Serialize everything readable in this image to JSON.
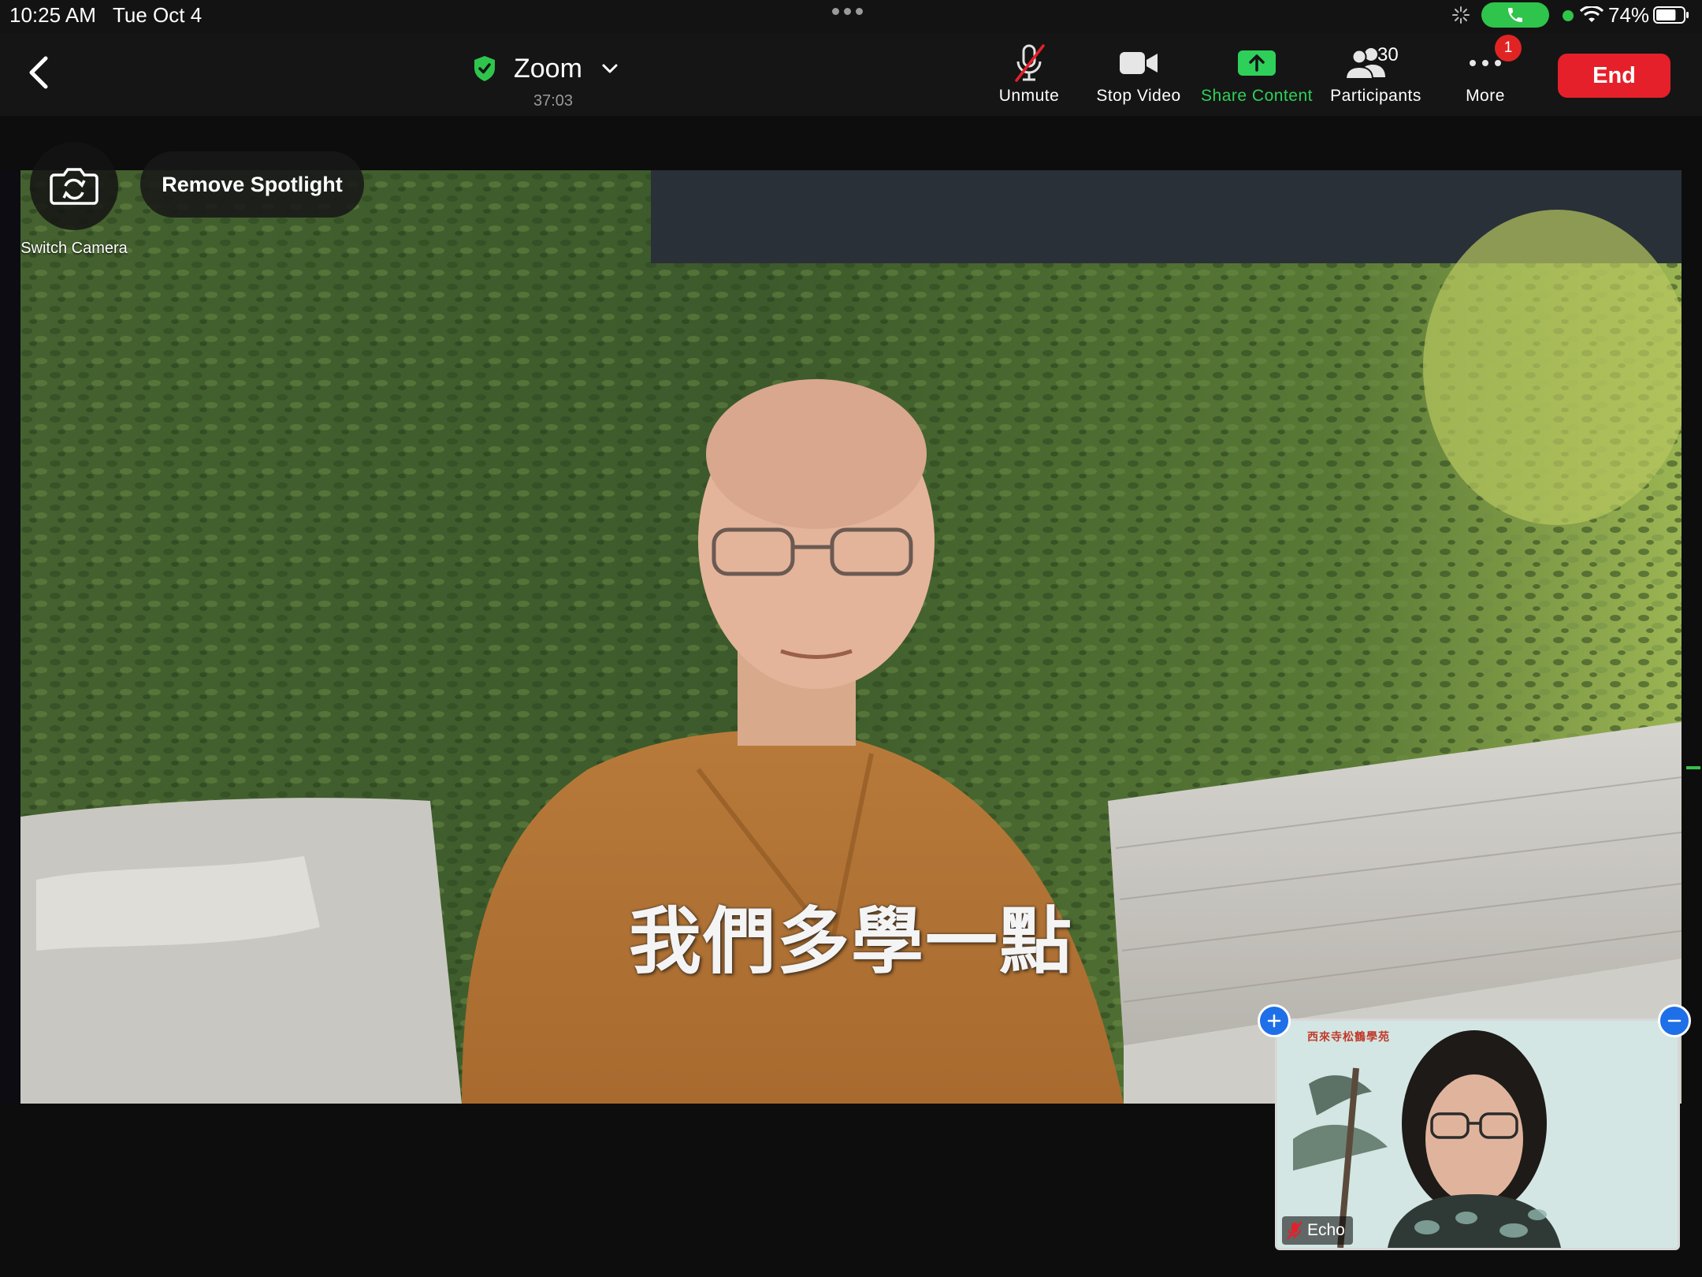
{
  "status_bar": {
    "time": "10:25 AM",
    "date": "Tue Oct 4",
    "battery_percent": "74%",
    "battery_level": 0.74,
    "call_active_color": "#2fc44c"
  },
  "toolbar": {
    "meeting_title": "Zoom",
    "meeting_elapsed": "37:03",
    "unmute_label": "Unmute",
    "stop_video_label": "Stop Video",
    "share_content_label": "Share Content",
    "participants_label": "Participants",
    "participants_count": "30",
    "more_label": "More",
    "more_badge": "1",
    "end_label": "End"
  },
  "video": {
    "switch_camera_label": "Switch Camera",
    "remove_spotlight_label": "Remove Spotlight",
    "subtitle": "我們多學一點"
  },
  "self_view": {
    "name": "Echo",
    "banner_text": "西來寺松鶴學苑"
  },
  "colors": {
    "accent_green": "#2fd05a",
    "end_red": "#e5202a",
    "badge_red": "#e02424",
    "pip_blue": "#1e6fe8"
  },
  "icons": [
    "back-chevron-icon",
    "shield-check-icon",
    "chevron-down-icon",
    "muted-mic-icon",
    "video-camera-icon",
    "share-arrow-icon",
    "participants-icon",
    "more-dots-icon",
    "switch-camera-icon",
    "plus-icon",
    "minus-icon",
    "wifi-icon",
    "battery-icon",
    "phone-icon"
  ]
}
